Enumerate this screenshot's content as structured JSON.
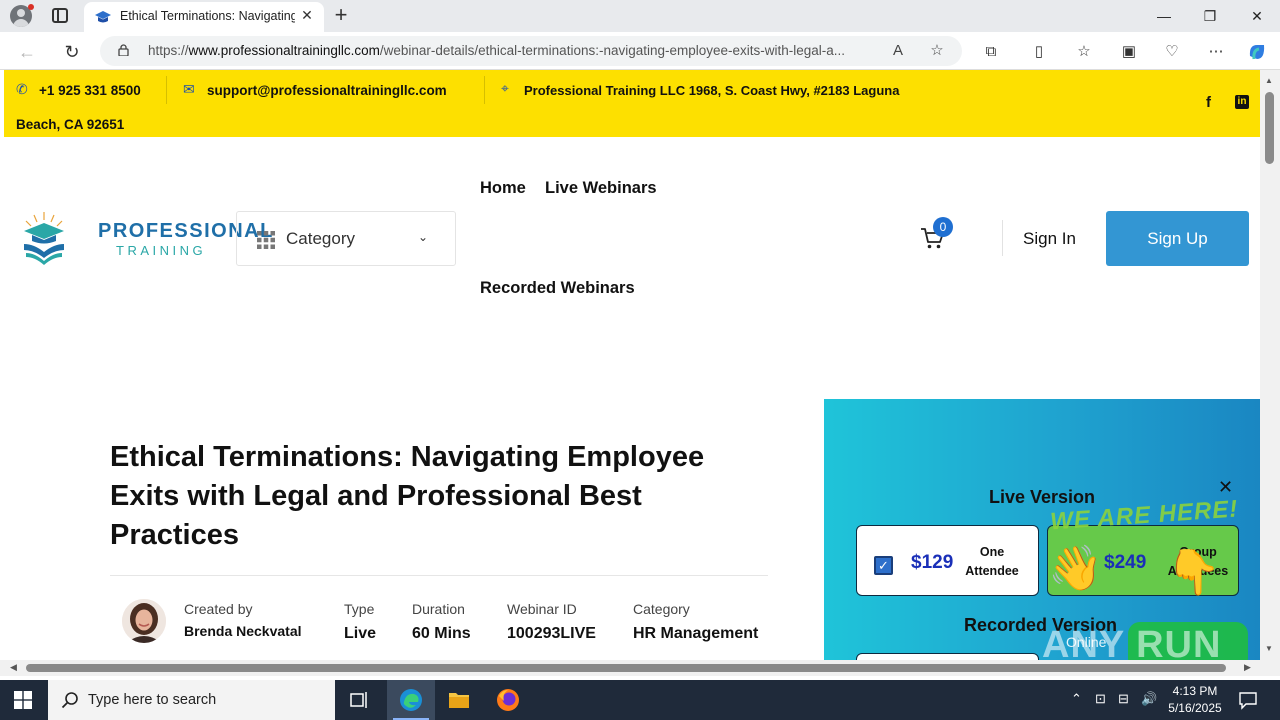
{
  "browser": {
    "tab_title": "Ethical Terminations: Navigating",
    "url_prefix": "https://",
    "url_host": "www.professionaltrainingllc.com",
    "url_path": "/webinar-details/ethical-terminations:-navigating-employee-exits-with-legal-a..."
  },
  "topbar": {
    "phone": "+1 925 331 8500",
    "email": "support@professionaltrainingllc.com",
    "address_line1": "Professional Training LLC 1968, S. Coast Hwy, #2183 Laguna",
    "address_line2": "Beach, CA 92651"
  },
  "header": {
    "logo_line1": "PROFESSIONAL",
    "logo_line2": "TRAINING",
    "category_label": "Category",
    "nav": [
      "Home",
      "Live Webinars",
      "Recorded Webinars"
    ],
    "cart_count": "0",
    "signin": "Sign In",
    "signup": "Sign Up"
  },
  "webinar": {
    "title": "Ethical Terminations: Navigating Employee Exits with Legal and Professional Best Practices",
    "created_by_label": "Created by",
    "created_by": "Brenda Neckvatal",
    "type_label": "Type",
    "type": "Live",
    "duration_label": "Duration",
    "duration": "60 Mins",
    "id_label": "Webinar ID",
    "id": "100293LIVE",
    "category_label": "Category",
    "category": "HR Management"
  },
  "pricing": {
    "live_heading": "Live Version",
    "option1_price": "$129",
    "option1_desc": "One Attendee",
    "option2_price": "$249",
    "option2_desc": "Group Attendees",
    "recorded_heading": "Recorded Version"
  },
  "widget": {
    "banner": "WE ARE HERE!",
    "brand": "ANY RUN",
    "status": "Online"
  },
  "taskbar": {
    "search_placeholder": "Type here to search",
    "time": "4:13 PM",
    "date": "5/16/2025"
  },
  "colors": {
    "topbar": "#fde000",
    "accent_blue": "#3396d3",
    "price_blue": "#1a2fb8",
    "group_green": "#66c94a"
  }
}
